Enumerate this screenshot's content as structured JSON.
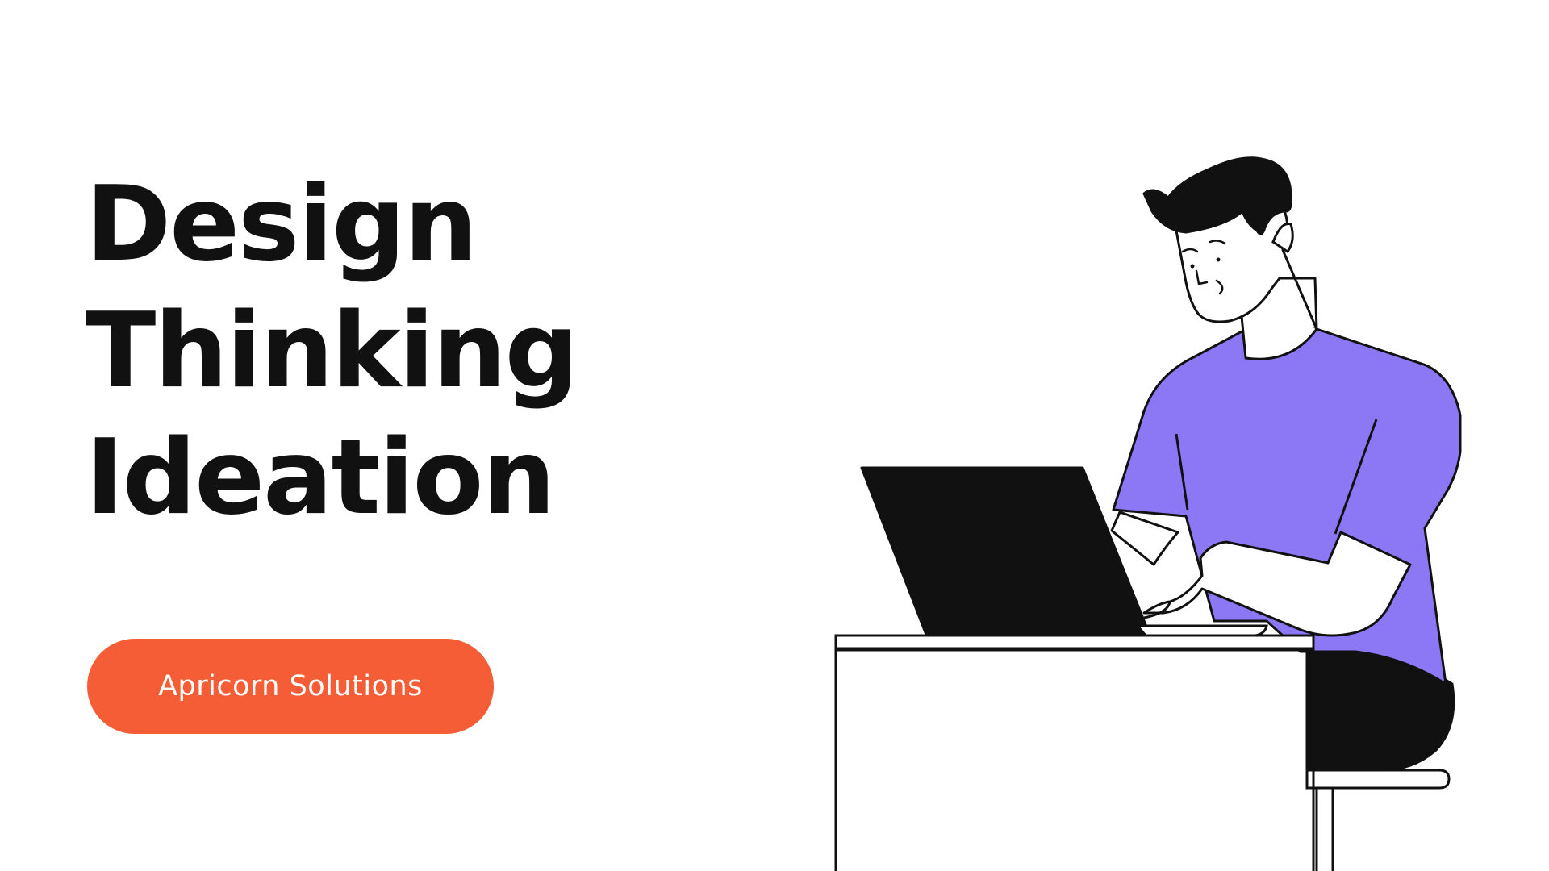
{
  "slide": {
    "title_lines": [
      "Design",
      "Thinking",
      "Ideation"
    ],
    "badge_label": "Apricorn Solutions"
  },
  "colors": {
    "background": "#ffffff",
    "text": "#111111",
    "accent": "#f45d35",
    "shirt": "#8c78f5",
    "ink": "#111111"
  },
  "illustration": {
    "icon": "person-working-on-laptop-illustration"
  }
}
